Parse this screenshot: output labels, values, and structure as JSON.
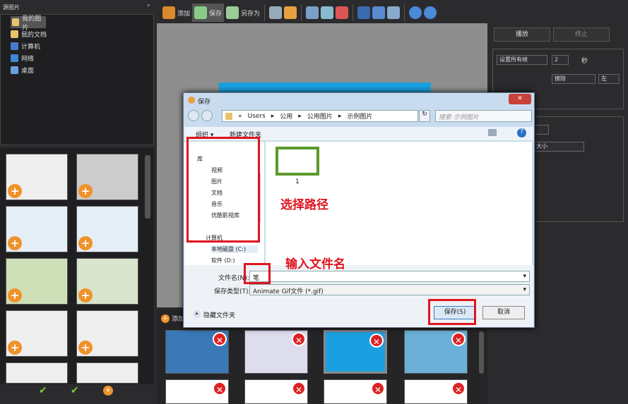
{
  "left": {
    "title": "源图片",
    "pin": "ᵖ",
    "tree": [
      "我的图片",
      "我的文档",
      "计算机",
      "网络",
      "桌面"
    ]
  },
  "toolbar": {
    "add": "添加",
    "save": "保存",
    "save_as": "另存为"
  },
  "right": {
    "play": "播放",
    "stop": "终止",
    "set_frames": "设置所有帧",
    "seconds_value": "2",
    "seconds_unit": "秒",
    "erase": "擦除",
    "align": "左",
    "size": "大小"
  },
  "strip": {
    "add": "添加"
  },
  "dialog": {
    "title": "保存",
    "close": "✕",
    "breadcrumb": [
      "«",
      "Users",
      "公用",
      "公用图片",
      "示例图片"
    ],
    "search_placeholder": "搜索 示例图片",
    "organize": "组织 ▾",
    "new_folder": "新建文件夹",
    "nav": [
      "库",
      "视频",
      "图片",
      "文档",
      "音乐",
      "优酷影视库",
      "计算机",
      "本地磁盘 (C:)",
      "软件 (D:)"
    ],
    "file": {
      "name": "1"
    },
    "filename_label": "文件名(N):",
    "filename_value": "笔",
    "filetype_label": "保存类型(T):",
    "filetype_value": "Animate Gif文件 (*.gif)",
    "hide_folders": "隐藏文件夹",
    "save": "保存(S)",
    "cancel": "取消"
  },
  "annotations": {
    "choose_path": "选择路径",
    "enter_name": "输入文件名"
  }
}
